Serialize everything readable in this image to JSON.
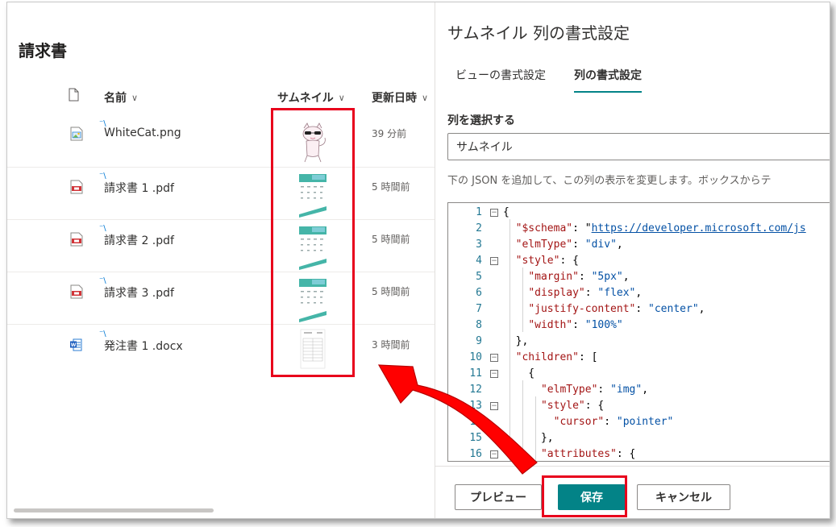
{
  "library": {
    "title": "請求書",
    "columns": {
      "name": "名前",
      "thumbnail": "サムネイル",
      "modified": "更新日時"
    },
    "files": [
      {
        "name": "WhiteCat.png",
        "modified": "39 分前",
        "type": "image"
      },
      {
        "name": "請求書 1 .pdf",
        "modified": "5 時間前",
        "type": "pdf"
      },
      {
        "name": "請求書 2 .pdf",
        "modified": "5 時間前",
        "type": "pdf"
      },
      {
        "name": "請求書 3 .pdf",
        "modified": "5 時間前",
        "type": "pdf"
      },
      {
        "name": "発注書 1 .docx",
        "modified": "3 時間前",
        "type": "word"
      }
    ]
  },
  "panel": {
    "title": "サムネイル 列の書式設定",
    "tabs": [
      "ビューの書式設定",
      "列の書式設定"
    ],
    "active_tab": "列の書式設定",
    "select_label": "列を選択する",
    "select_value": "サムネイル",
    "description": "下の JSON を追加して、この列の表示を変更します。ボックスからテ",
    "buttons": {
      "preview": "プレビュー",
      "save": "保存",
      "cancel": "キャンセル"
    },
    "code": {
      "schema_key": "\"$schema\"",
      "schema_url": "https://developer.microsoft.com/js",
      "elmType_key": "\"elmType\"",
      "div_value": "\"div\"",
      "style_key": "\"style\"",
      "margin_key": "\"margin\"",
      "margin_value": "\"5px\"",
      "display_key": "\"display\"",
      "flex_value": "\"flex\"",
      "justify_key": "\"justify-content\"",
      "center_value": "\"center\"",
      "width_key": "\"width\"",
      "width_value": "\"100%\"",
      "children_key": "\"children\"",
      "img_value": "\"img\"",
      "cursor_key": "\"cursor\"",
      "pointer_value": "\"pointer\"",
      "attributes_key": "\"attributes\""
    }
  },
  "colors": {
    "accent": "#038387",
    "annotation": "#e8001c",
    "link": "#0451a5",
    "json_key": "#a31515"
  }
}
